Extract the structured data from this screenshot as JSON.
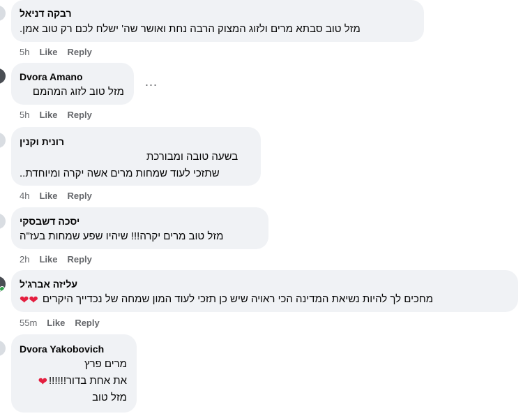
{
  "comments": [
    {
      "author": "רבקה דניאל",
      "lines": [
        "מזל טוב סבתא מרים ולזוג המצוק הרבה נחת ואושר שה' ישלח לכם רק טוב אמן."
      ],
      "time": "5h",
      "like": "Like",
      "reply": "Reply"
    },
    {
      "author": "Dvora Amano",
      "lines": [
        "מזל טוב לזוג המהמם"
      ],
      "time": "5h",
      "like": "Like",
      "reply": "Reply",
      "more": "..."
    },
    {
      "author": "רונית וקנין",
      "lines": [
        "בשעה טובה ומבורכת",
        "שתזכי לעוד שמחות מרים אשה יקרה ומיוחדת.."
      ],
      "time": "4h",
      "like": "Like",
      "reply": "Reply"
    },
    {
      "author": "יסכה דשבסקי",
      "lines": [
        "מזל טוב מרים יקרה!!! שיהיו שפע שמחות בעז\"ה"
      ],
      "time": "2h",
      "like": "Like",
      "reply": "Reply"
    },
    {
      "author": "עליזה אברג'ל",
      "lines": [
        "מחכים לך להיות נשיאת המדינה הכי ראויה שיש כן תזכי לעוד המון שמחה של נכדייך היקרים"
      ],
      "emoji": "❤❤",
      "time": "55m",
      "like": "Like",
      "reply": "Reply"
    },
    {
      "author": "Dvora Yakobovich",
      "lines": [
        "מרים פרץ",
        "את אחת בדור!!!!!!",
        "מזל טוב"
      ],
      "line2_emoji": "❤",
      "time": "",
      "like": "",
      "reply": ""
    }
  ]
}
